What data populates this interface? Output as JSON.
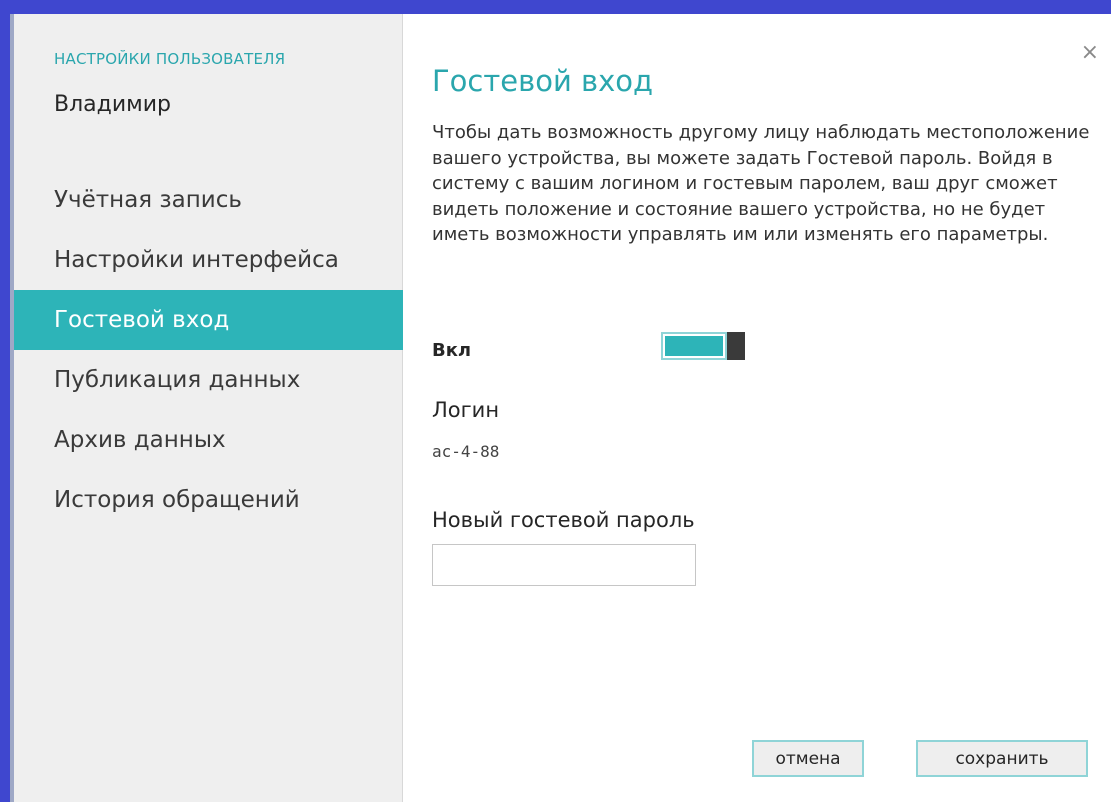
{
  "sidebar": {
    "header": "НАСТРОЙКИ ПОЛЬЗОВАТЕЛЯ",
    "user": "Владимир",
    "items": [
      {
        "label": "Учётная запись",
        "active": false
      },
      {
        "label": "Настройки интерфейса",
        "active": false
      },
      {
        "label": "Гостевой вход",
        "active": true
      },
      {
        "label": "Публикация данных",
        "active": false
      },
      {
        "label": "Архив данных",
        "active": false
      },
      {
        "label": "История обращений",
        "active": false
      }
    ]
  },
  "main": {
    "close": "×",
    "title": "Гостевой вход",
    "description": "Чтобы дать возможность другому лицу наблюдать местоположение вашего устройства, вы можете задать Гостевой пароль. Войдя в систему с вашим логином и гостевым паролем, ваш друг сможет видеть положение и состояние вашего устройства, но не будет иметь возможности управлять им или изменять его параметры.",
    "toggle": {
      "label": "Вкл",
      "on": true
    },
    "login": {
      "label": "Логин",
      "value": "ac-4-88"
    },
    "password": {
      "label": "Новый гостевой пароль",
      "value": ""
    },
    "buttons": {
      "cancel": "отмена",
      "save": "сохранить"
    }
  },
  "colors": {
    "accent": "#2db4b8",
    "background": "#3f47cf",
    "sidebar": "#efefef"
  }
}
